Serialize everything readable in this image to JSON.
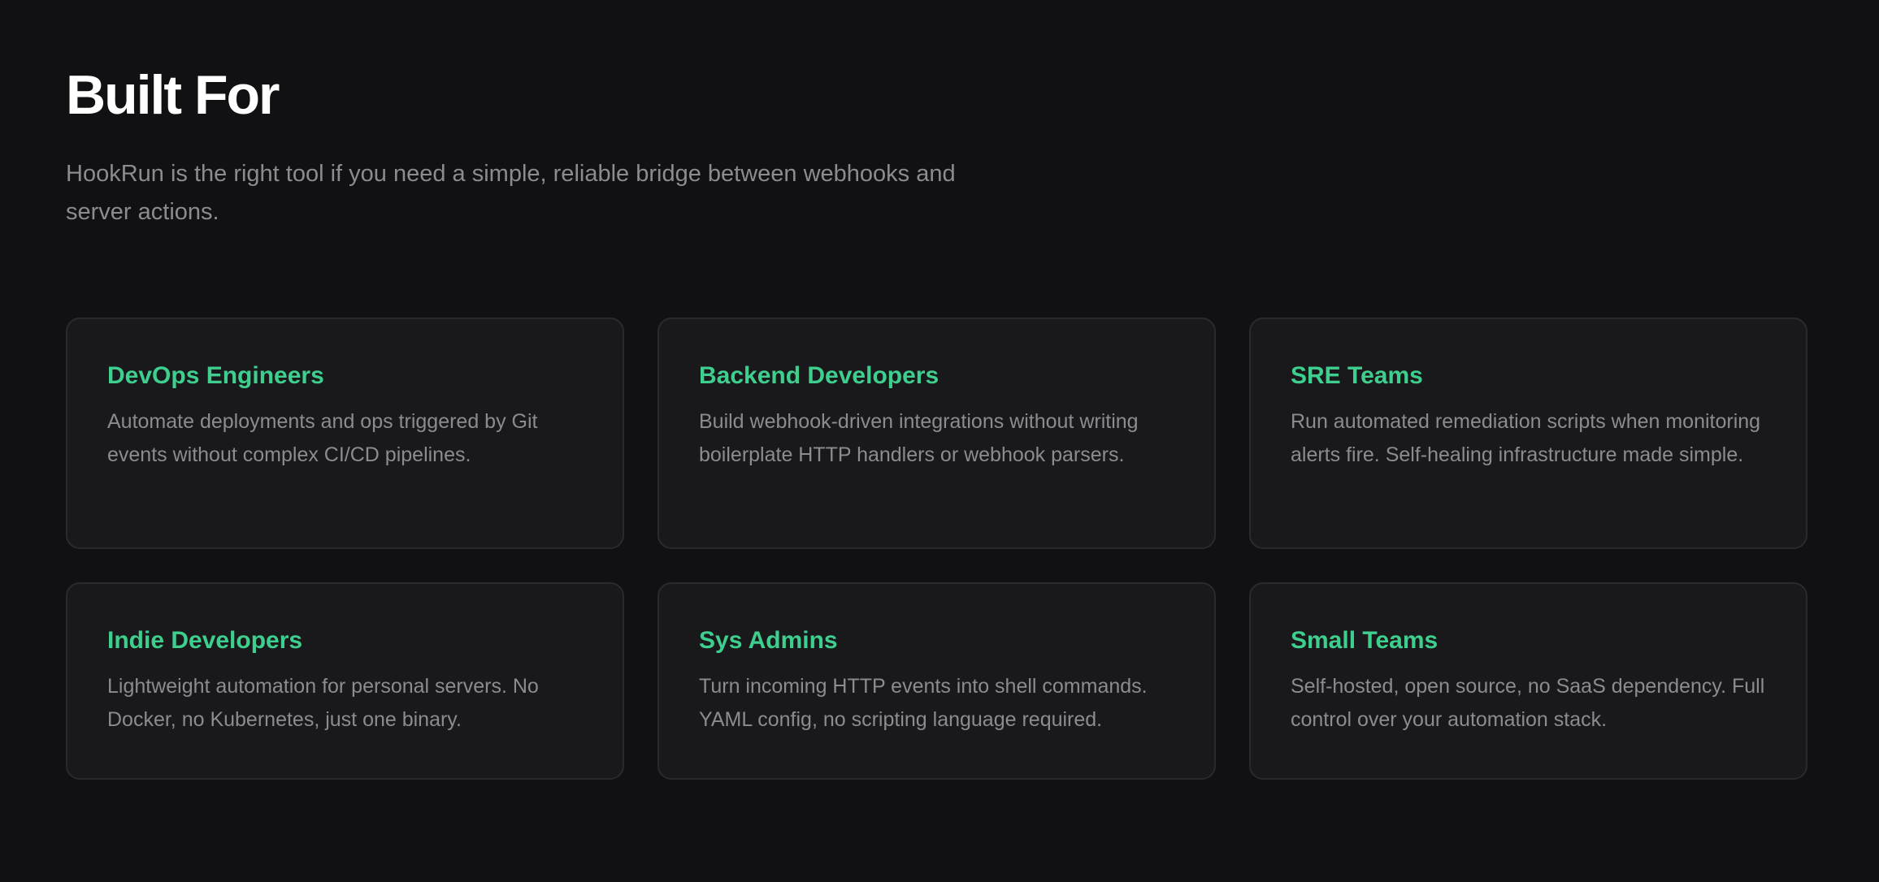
{
  "section": {
    "title": "Built For",
    "subtitle": "HookRun is the right tool if you need a simple, reliable bridge between webhooks and server actions."
  },
  "cards": [
    {
      "title": "DevOps Engineers",
      "description": "Automate deployments and ops triggered by Git events without complex CI/CD pipelines."
    },
    {
      "title": "Backend Developers",
      "description": "Build webhook-driven integrations without writing boilerplate HTTP handlers or webhook parsers."
    },
    {
      "title": "SRE Teams",
      "description": "Run automated remediation scripts when monitoring alerts fire. Self-healing infrastructure made simple."
    },
    {
      "title": "Indie Developers",
      "description": "Lightweight automation for personal servers. No Docker, no Kubernetes, just one binary."
    },
    {
      "title": "Sys Admins",
      "description": "Turn incoming HTTP events into shell commands. YAML config, no scripting language required."
    },
    {
      "title": "Small Teams",
      "description": "Self-hosted, open source, no SaaS dependency. Full control over your automation stack."
    }
  ],
  "colors": {
    "background": "#111113",
    "card_background": "#19191c",
    "card_border": "#2a2a2e",
    "accent": "#3ecf8e",
    "heading": "#ffffff",
    "muted_text": "#8b8b90"
  }
}
